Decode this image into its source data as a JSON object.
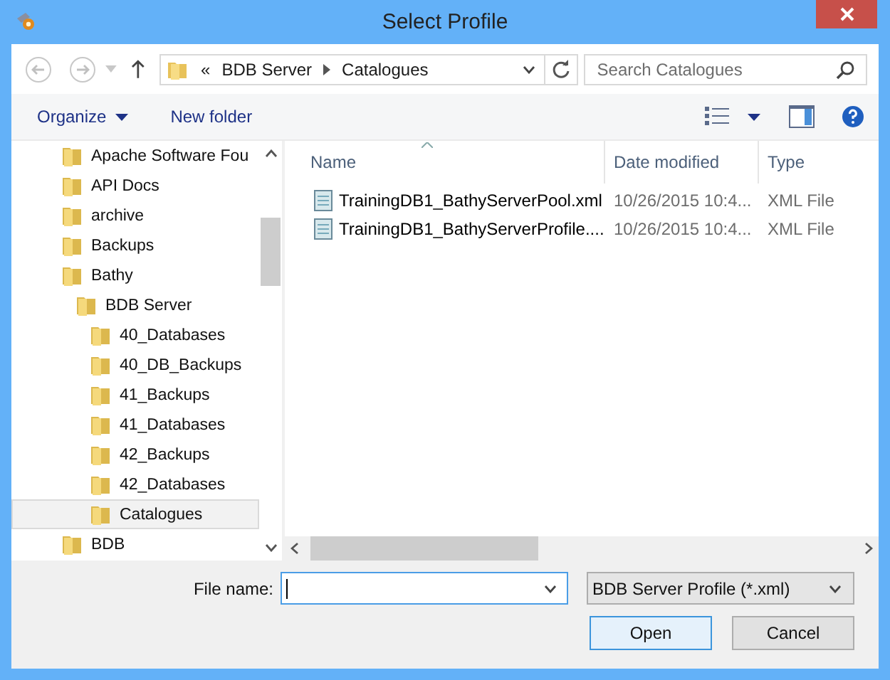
{
  "window": {
    "title": "Select Profile"
  },
  "address": {
    "overflow": "«",
    "crumbs": [
      "BDB Server",
      "Catalogues"
    ]
  },
  "search": {
    "placeholder": "Search Catalogues"
  },
  "toolbar": {
    "organize": "Organize",
    "new_folder": "New folder"
  },
  "tree": {
    "items": [
      {
        "label": "Apache Software Fou",
        "selected": false
      },
      {
        "label": "API Docs",
        "selected": false
      },
      {
        "label": "archive",
        "selected": false
      },
      {
        "label": "Backups",
        "selected": false
      },
      {
        "label": "Bathy",
        "selected": false,
        "children": [
          {
            "label": "BDB Server",
            "selected": false,
            "children": [
              {
                "label": "40_Databases",
                "selected": false
              },
              {
                "label": "40_DB_Backups",
                "selected": false
              },
              {
                "label": "41_Backups",
                "selected": false
              },
              {
                "label": "41_Databases",
                "selected": false
              },
              {
                "label": "42_Backups",
                "selected": false
              },
              {
                "label": "42_Databases",
                "selected": false
              },
              {
                "label": "Catalogues",
                "selected": true
              }
            ]
          }
        ]
      },
      {
        "label": "BDB",
        "selected": false
      }
    ]
  },
  "files": {
    "columns": [
      "Name",
      "Date modified",
      "Type"
    ],
    "rows": [
      {
        "name": "TrainingDB1_BathyServerPool.xml",
        "date": "10/26/2015 10:4...",
        "type": "XML File"
      },
      {
        "name": "TrainingDB1_BathyServerProfile....",
        "date": "10/26/2015 10:4...",
        "type": "XML File"
      }
    ]
  },
  "file_name": {
    "label": "File name:"
  },
  "file_type": {
    "value": "BDB Server Profile (*.xml)"
  },
  "buttons": [
    "Open",
    "Cancel"
  ]
}
